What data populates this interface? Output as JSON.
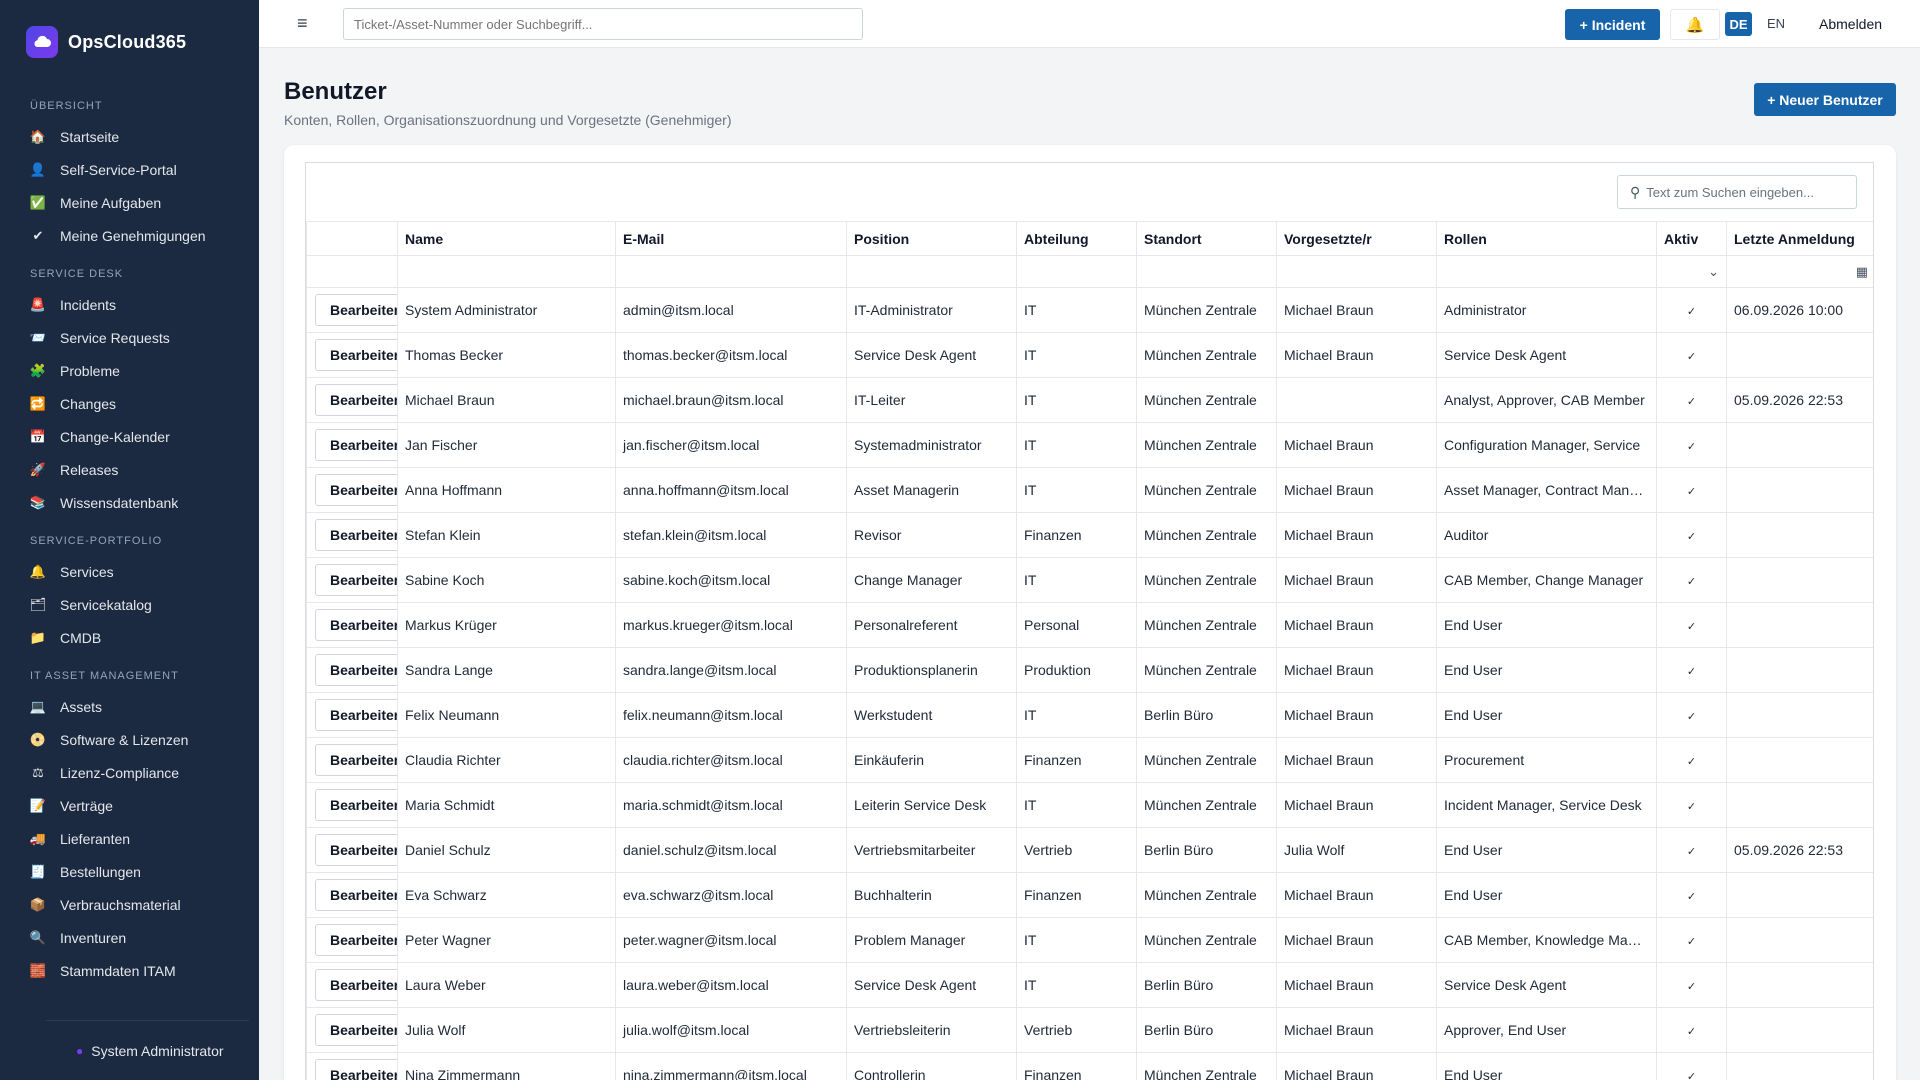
{
  "app": {
    "name": "OpsCloud365"
  },
  "sidebar": {
    "sections": [
      {
        "title": "Übersicht",
        "items": [
          "Startseite",
          "Self-Service-Portal",
          "Meine Aufgaben",
          "Meine Genehmigungen"
        ]
      },
      {
        "title": "Service Desk",
        "items": [
          "Incidents",
          "Service Requests",
          "Probleme",
          "Changes",
          "Change-Kalender",
          "Releases",
          "Wissensdatenbank"
        ]
      },
      {
        "title": "Service-Portfolio",
        "items": [
          "Services",
          "Servicekatalog",
          "CMDB"
        ]
      },
      {
        "title": "IT Asset Management",
        "items": [
          "Assets",
          "Software & Lizenzen",
          "Lizenz-Compliance",
          "Verträge",
          "Lieferanten",
          "Bestellungen",
          "Verbrauchsmaterial",
          "Inventuren",
          "Stammdaten ITAM"
        ]
      }
    ],
    "user": "System Administrator"
  },
  "topbar": {
    "search_placeholder": "Ticket-/Asset-Nummer oder Suchbegriff...",
    "incident_button": "+ Incident",
    "lang_de": "DE",
    "lang_en": "EN",
    "logout": "Abmelden"
  },
  "page": {
    "title": "Benutzer",
    "subtitle": "Konten, Rollen, Organisationszuordnung und Vorgesetzte (Genehmiger)",
    "new_button": "+ Neuer Benutzer"
  },
  "grid": {
    "search_placeholder": "Text zum Suchen eingeben...",
    "edit_label": "Bearbeiten",
    "columns": [
      "",
      "Name",
      "E-Mail",
      "Position",
      "Abteilung",
      "Standort",
      "Vorgesetzte/r",
      "Rollen",
      "Aktiv",
      "Letzte Anmeldung"
    ],
    "rows": [
      [
        "System Administrator",
        "admin@itsm.local",
        "IT-Administrator",
        "IT",
        "München Zentrale",
        "Michael Braun",
        "Administrator",
        "06.09.2026 10:00"
      ],
      [
        "Thomas Becker",
        "thomas.becker@itsm.local",
        "Service Desk Agent",
        "IT",
        "München Zentrale",
        "Michael Braun",
        "Service Desk Agent",
        ""
      ],
      [
        "Michael Braun",
        "michael.braun@itsm.local",
        "IT-Leiter",
        "IT",
        "München Zentrale",
        "",
        "Analyst, Approver, CAB Member",
        "05.09.2026 22:53"
      ],
      [
        "Jan Fischer",
        "jan.fischer@itsm.local",
        "Systemadministrator",
        "IT",
        "München Zentrale",
        "Michael Braun",
        "Configuration Manager, Service",
        ""
      ],
      [
        "Anna Hoffmann",
        "anna.hoffmann@itsm.local",
        "Asset Managerin",
        "IT",
        "München Zentrale",
        "Michael Braun",
        "Asset Manager, Contract Manager",
        ""
      ],
      [
        "Stefan Klein",
        "stefan.klein@itsm.local",
        "Revisor",
        "Finanzen",
        "München Zentrale",
        "Michael Braun",
        "Auditor",
        ""
      ],
      [
        "Sabine Koch",
        "sabine.koch@itsm.local",
        "Change Manager",
        "IT",
        "München Zentrale",
        "Michael Braun",
        "CAB Member, Change Manager",
        ""
      ],
      [
        "Markus Krüger",
        "markus.krueger@itsm.local",
        "Personalreferent",
        "Personal",
        "München Zentrale",
        "Michael Braun",
        "End User",
        ""
      ],
      [
        "Sandra Lange",
        "sandra.lange@itsm.local",
        "Produktionsplanerin",
        "Produktion",
        "München Zentrale",
        "Michael Braun",
        "End User",
        ""
      ],
      [
        "Felix Neumann",
        "felix.neumann@itsm.local",
        "Werkstudent",
        "IT",
        "Berlin Büro",
        "Michael Braun",
        "End User",
        ""
      ],
      [
        "Claudia Richter",
        "claudia.richter@itsm.local",
        "Einkäuferin",
        "Finanzen",
        "München Zentrale",
        "Michael Braun",
        "Procurement",
        ""
      ],
      [
        "Maria Schmidt",
        "maria.schmidt@itsm.local",
        "Leiterin Service Desk",
        "IT",
        "München Zentrale",
        "Michael Braun",
        "Incident Manager, Service Desk",
        ""
      ],
      [
        "Daniel Schulz",
        "daniel.schulz@itsm.local",
        "Vertriebsmitarbeiter",
        "Vertrieb",
        "Berlin Büro",
        "Julia Wolf",
        "End User",
        "05.09.2026 22:53"
      ],
      [
        "Eva Schwarz",
        "eva.schwarz@itsm.local",
        "Buchhalterin",
        "Finanzen",
        "München Zentrale",
        "Michael Braun",
        "End User",
        ""
      ],
      [
        "Peter Wagner",
        "peter.wagner@itsm.local",
        "Problem Manager",
        "IT",
        "München Zentrale",
        "Michael Braun",
        "CAB Member, Knowledge Manager",
        ""
      ],
      [
        "Laura Weber",
        "laura.weber@itsm.local",
        "Service Desk Agent",
        "IT",
        "Berlin Büro",
        "Michael Braun",
        "Service Desk Agent",
        ""
      ],
      [
        "Julia Wolf",
        "julia.wolf@itsm.local",
        "Vertriebsleiterin",
        "Vertrieb",
        "Berlin Büro",
        "Michael Braun",
        "Approver, End User",
        ""
      ],
      [
        "Nina Zimmermann",
        "nina.zimmermann@itsm.local",
        "Controllerin",
        "Finanzen",
        "München Zentrale",
        "Michael Braun",
        "End User",
        ""
      ]
    ]
  },
  "colors": {
    "sidebar_bg": "#1b2a41",
    "primary": "#1864ab",
    "bell": "#f59f00"
  }
}
